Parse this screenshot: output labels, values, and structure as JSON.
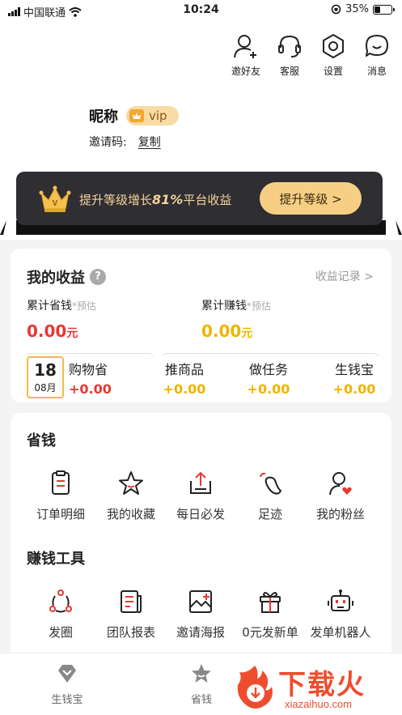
{
  "status_bar": {
    "carrier": "中国联通",
    "time": "10:24",
    "battery": "35%",
    "battery_level": 0.35
  },
  "top_actions": [
    {
      "label": "邀好友",
      "icon": "add-user-icon"
    },
    {
      "label": "客服",
      "icon": "headset-icon"
    },
    {
      "label": "设置",
      "icon": "settings-icon"
    },
    {
      "label": "消息",
      "icon": "message-icon"
    }
  ],
  "profile": {
    "nickname": "昵称",
    "vip_label": "vip",
    "invite_label": "邀请码:",
    "copy_label": "复制"
  },
  "vip_banner": {
    "text_prefix": "提升等级增长",
    "percent": "81%",
    "text_suffix": "平台收益",
    "button": "提升等级 >"
  },
  "earnings": {
    "title": "我的收益",
    "help": "?",
    "record_link": "收益记录 >",
    "saved_label": "累计省钱",
    "saved_hint": "*预估",
    "saved_value": "0.00",
    "saved_unit": "元",
    "earned_label": "累计赚钱",
    "earned_hint": "*预估",
    "earned_value": "0.00",
    "earned_unit": "元",
    "calendar": {
      "day": "18",
      "month": "08月"
    },
    "shopping": {
      "label": "购物省",
      "value": "+0.00"
    },
    "stats": [
      {
        "label": "推商品",
        "value": "+0.00"
      },
      {
        "label": "做任务",
        "value": "+0.00"
      },
      {
        "label": "生钱宝",
        "value": "+0.00"
      }
    ],
    "colors": {
      "saved": "#e53935",
      "earned": "#f0b400"
    }
  },
  "save_section": {
    "title": "省钱",
    "items": [
      {
        "label": "订单明细",
        "icon": "order-list-icon"
      },
      {
        "label": "我的收藏",
        "icon": "star-icon"
      },
      {
        "label": "每日必发",
        "icon": "upload-icon"
      },
      {
        "label": "足迹",
        "icon": "footprint-icon"
      },
      {
        "label": "我的粉丝",
        "icon": "fans-icon"
      }
    ]
  },
  "earn_tools": {
    "title": "赚钱工具",
    "items": [
      {
        "label": "发圈",
        "icon": "share-circle-icon"
      },
      {
        "label": "团队报表",
        "icon": "report-icon"
      },
      {
        "label": "邀请海报",
        "icon": "poster-icon"
      },
      {
        "label": "0元发新单",
        "icon": "gift-icon"
      },
      {
        "label": "发单机器人",
        "icon": "robot-icon"
      }
    ]
  },
  "tabbar": [
    {
      "label": "生钱宝",
      "icon": "diamond-icon"
    },
    {
      "label": "省钱",
      "icon": "star-tab-icon"
    }
  ],
  "watermark": {
    "text": "下载火",
    "sub": "xiazaihuo.com"
  }
}
